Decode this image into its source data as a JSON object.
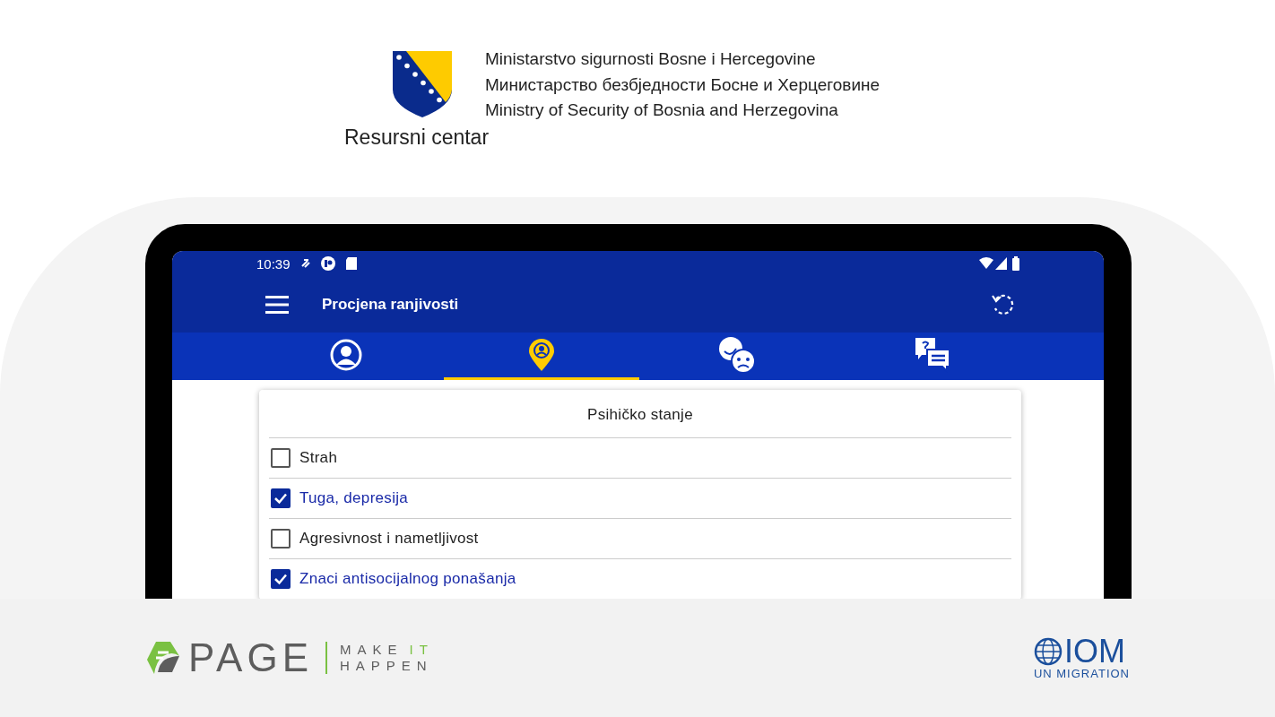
{
  "header": {
    "ministry_lines": [
      "Ministarstvo sigurnosti Bosne i Hercegovine",
      "Министарство безбједности Босне и Херцеговине",
      "Ministry of Security of Bosnia and Herzegovina"
    ],
    "subtitle": "Resursni centar"
  },
  "status_bar": {
    "time": "10:39"
  },
  "app_bar": {
    "title": "Procjena ranjivosti"
  },
  "tabs": [
    {
      "kind": "profile",
      "selected": false
    },
    {
      "kind": "location",
      "selected": true
    },
    {
      "kind": "emotions",
      "selected": false
    },
    {
      "kind": "questions",
      "selected": false
    }
  ],
  "card": {
    "title": "Psihičko stanje",
    "items": [
      {
        "label": "Strah",
        "checked": false
      },
      {
        "label": "Tuga, depresija",
        "checked": true
      },
      {
        "label": "Agresivnost i nametljivost",
        "checked": false
      },
      {
        "label": "Znaci antisocijalnog ponašanja",
        "checked": true
      }
    ]
  },
  "footer": {
    "page_logo": {
      "name": "PAGE",
      "tagline_1": "MAKE",
      "tagline_2": "IT",
      "tagline_3": "HAPPEN"
    },
    "iom_logo": {
      "name": "IOM",
      "tagline": "UN MIGRATION"
    }
  }
}
